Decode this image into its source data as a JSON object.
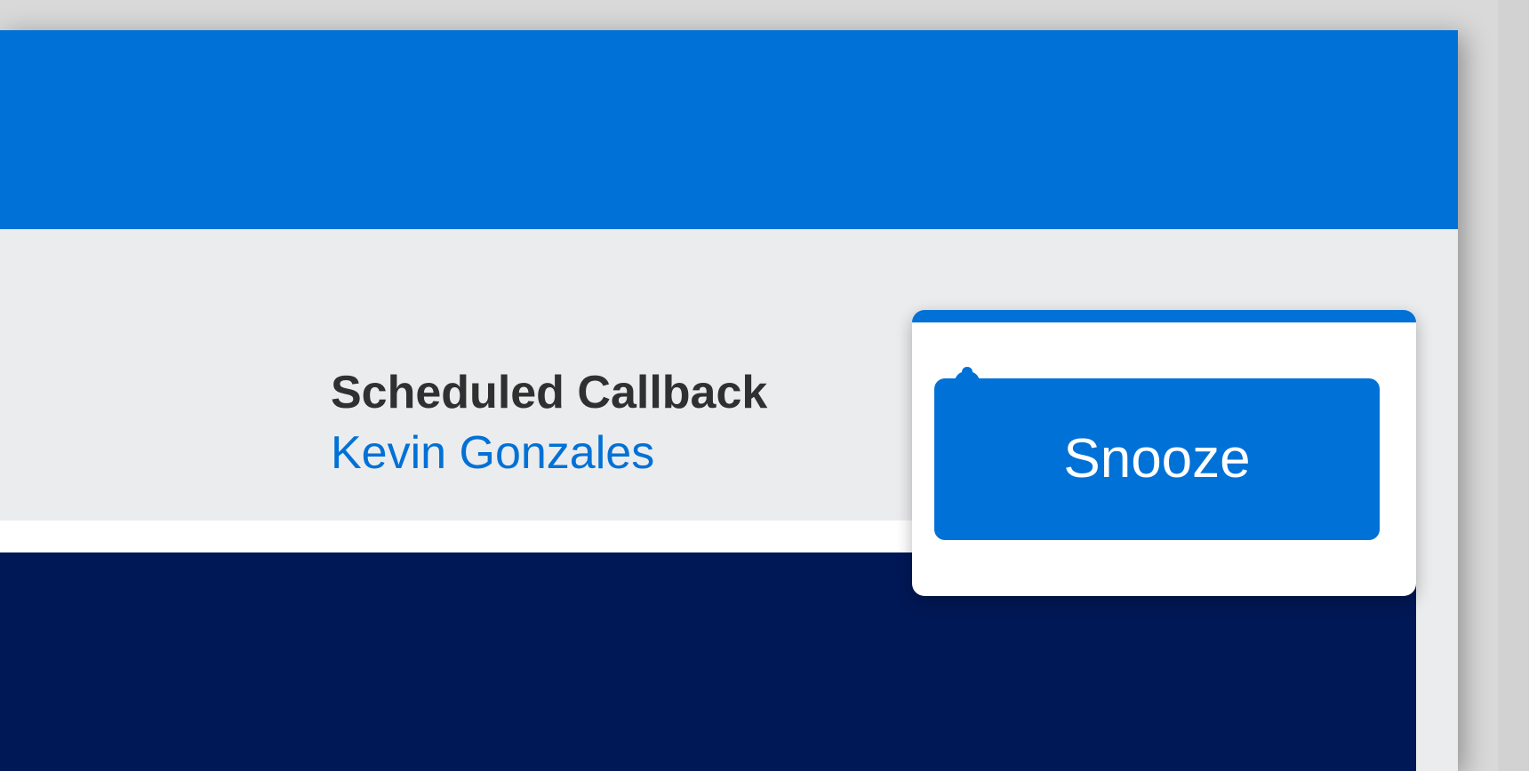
{
  "notification": {
    "icon": "bell-icon",
    "title": "Scheduled Callback",
    "subtitle": "Kevin Gonzales",
    "button_label": "Snooze"
  },
  "colors": {
    "accent": "#0071d6",
    "dark_panel": "#001856",
    "background": "#ebecee",
    "title_text": "#303030"
  }
}
